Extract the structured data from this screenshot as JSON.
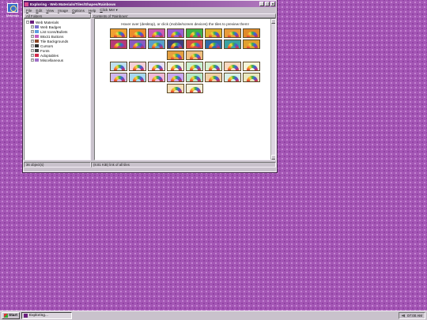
{
  "desktop": {
    "icon_label": "Materials"
  },
  "window": {
    "title": "Exploring - Web Materials/Tiles/Shapes/Rainbows",
    "buttons": [
      "_",
      "□",
      "x"
    ],
    "menu": [
      "File",
      "Edit",
      "View",
      "Image",
      "Options",
      "Help",
      "Click Me! ▾"
    ],
    "left_header": "All Folders",
    "right_header": "Contents of 'Rainbows'",
    "tree": {
      "root": "Web Materials",
      "items": [
        {
          "label": "Web Badges",
          "icon": "badge-icon",
          "color": "#7a6fcf"
        },
        {
          "label": "List Icons/Bullets",
          "icon": "bullet-icon",
          "color": "#5c9fe0"
        },
        {
          "label": "88x31 Buttons",
          "icon": "button-icon",
          "color": "#c45fc0"
        },
        {
          "label": "Tile Backgrounds",
          "icon": "tile-icon",
          "color": "#8e4a2a"
        },
        {
          "label": "Cursors",
          "icon": "cursor-icon",
          "color": "#333333"
        },
        {
          "label": "Fonts",
          "icon": "font-icon",
          "color": "#444444"
        },
        {
          "label": "Adoptables",
          "icon": "heart-icon",
          "color": "#d42a4b"
        },
        {
          "label": "Miscellaneous",
          "icon": "misc-icon",
          "color": "#a070c8"
        }
      ]
    },
    "hint": "Hover over (desktop), or click (mobile/screen devices) the tiles to preview them!",
    "tile_rows": [
      [
        "#f0a030",
        "#ed8b2c",
        "#ce5bb0",
        "#9b5fd0",
        "#41b24a",
        "#e0b22e",
        "#e89b3a",
        "#e08a2a"
      ],
      [
        "#b63a78",
        "#8a5bc0",
        "#5aa0c8",
        "#3f3f7e",
        "#d44a4a",
        "#2f6aa8",
        "#3aa2a2",
        "#e0a030"
      ],
      [
        "#e6a040",
        "#f0c080"
      ],
      [
        "#bfe0f0",
        "#f4d0d8",
        "#e8e0f4",
        "#f0f0d8",
        "#c8f0d0",
        "#d8f0d0",
        "#f8d8c0",
        "#f4f4d8"
      ],
      [
        "#d0b8f0",
        "#a8d8f0",
        "#f0b8d8",
        "#c8a8f0",
        "#b8e8c8",
        "#f0d0a8",
        "#d8f0e8",
        "#e8e8c0"
      ],
      [
        "#f8e0b8",
        "#f4f0d8"
      ]
    ],
    "status_left": "36 object(s)",
    "status_right": "(8.81 KiB) link of all tiles"
  },
  "taskbar": {
    "start_label": "Start",
    "task_label": "Exploring...",
    "clock": "07:00 AM"
  }
}
